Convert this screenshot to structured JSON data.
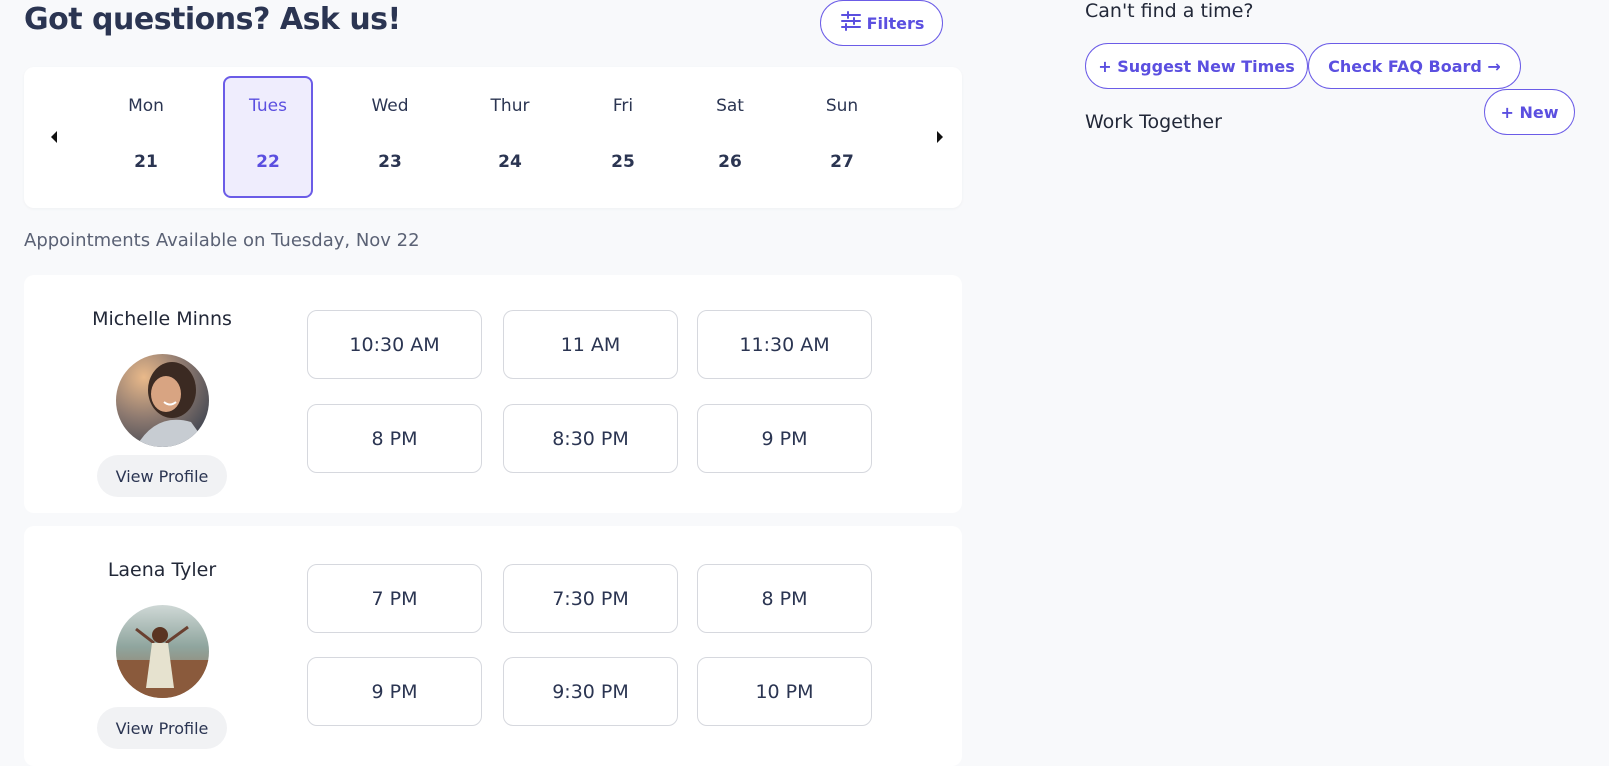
{
  "header": {
    "title": "Got questions? Ask us!",
    "filters_label": "Filters"
  },
  "week": {
    "days": [
      {
        "name": "Mon",
        "num": "21"
      },
      {
        "name": "Tues",
        "num": "22"
      },
      {
        "name": "Wed",
        "num": "23"
      },
      {
        "name": "Thur",
        "num": "24"
      },
      {
        "name": "Fri",
        "num": "25"
      },
      {
        "name": "Sat",
        "num": "26"
      },
      {
        "name": "Sun",
        "num": "27"
      }
    ]
  },
  "availability_label": "Appointments Available on Tuesday, Nov 22",
  "people": [
    {
      "name": "Michelle Minns",
      "view_profile": "View Profile",
      "slots": [
        "10:30 AM",
        "11 AM",
        "11:30 AM",
        "8 PM",
        "8:30 PM",
        "9 PM"
      ]
    },
    {
      "name": "Laena Tyler",
      "view_profile": "View Profile",
      "slots": [
        "7 PM",
        "7:30 PM",
        "8 PM",
        "9 PM",
        "9:30 PM",
        "10 PM"
      ]
    }
  ],
  "sidebar": {
    "cant_find": "Can't find a time?",
    "suggest_label": "+ Suggest New Times",
    "faq_label": "Check FAQ Board →",
    "work_together": "Work Together",
    "new_label": "+ New"
  },
  "colors": {
    "accent": "#5b4fe0",
    "selected_bg": "#efedfd",
    "page_bg": "#f8f9fb"
  }
}
